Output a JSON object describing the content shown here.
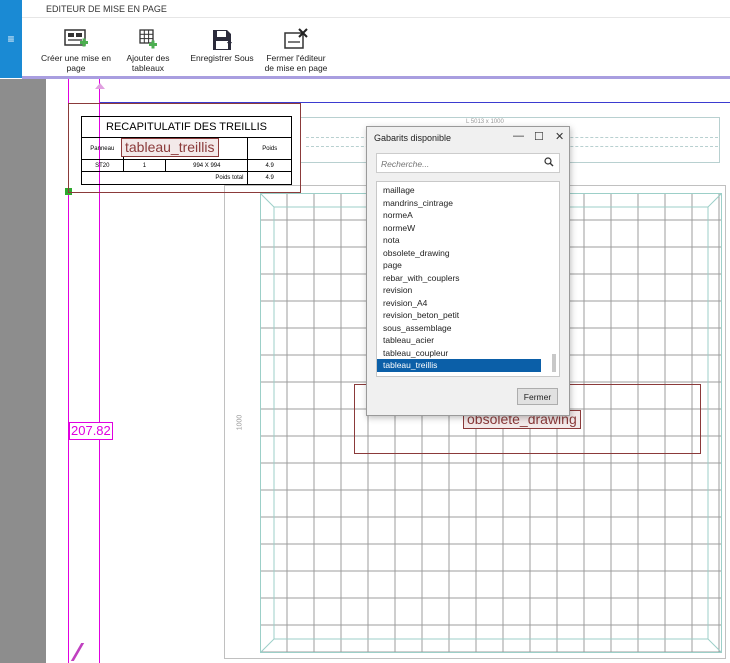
{
  "ribbon": {
    "title": "EDITEUR DE MISE EN PAGE",
    "menu_glyph": "≡",
    "buttons": [
      {
        "label": "Créer une mise en\npage",
        "icon": "create-layout-icon"
      },
      {
        "label": "Ajouter des\ntableaux",
        "icon": "add-table-icon"
      },
      {
        "label": "Enregistrer Sous",
        "icon": "save-as-icon"
      },
      {
        "label": "Fermer l'éditeur\nde mise en page",
        "icon": "close-editor-icon"
      }
    ]
  },
  "layout": {
    "dimension_value": "207.82",
    "recap_table": {
      "title": "RECAPITULATIF DES TREILLIS",
      "headers": [
        "Panneau",
        "Poids"
      ],
      "row": [
        "ST20",
        "1",
        "994 X 994",
        "4.9"
      ],
      "total_label": "Poids total",
      "total_value": "4.9"
    },
    "table_tag": "tableau_treillis",
    "drawing_tag": "obsolete_drawing",
    "top_dimension": "L 5013 x 1000",
    "side_dimension": "1000"
  },
  "dialog": {
    "title": "Gabarits disponible",
    "search_placeholder": "Recherche...",
    "items": [
      "maillage",
      "mandrins_cintrage",
      "normeA",
      "normeW",
      "nota",
      "obsolete_drawing",
      "page",
      "rebar_with_couplers",
      "revision",
      "revision_A4",
      "revision_beton_petit",
      "sous_assemblage",
      "tableau_acier",
      "tableau_coupleur",
      "tableau_treillis"
    ],
    "selected": "tableau_treillis",
    "close_button": "Fermer"
  },
  "colors": {
    "accent": "#1a8ad4",
    "selection": "#0b5fa8",
    "magenta": "#e000e0",
    "tag_red": "#8b3a3a"
  }
}
